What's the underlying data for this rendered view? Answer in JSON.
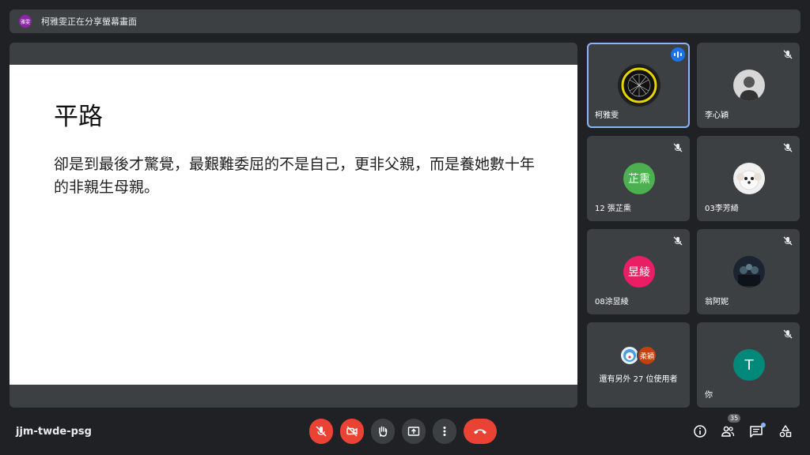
{
  "presentation_banner": {
    "avatar_text": "雅雯",
    "text": "柯雅雯正在分享螢幕畫面"
  },
  "slide": {
    "title": "平路",
    "body": "卻是到最後才驚覺，最艱難委屈的不是自己，更非父親，而是養她數十年的非親生母親。"
  },
  "participants": [
    {
      "name": "柯雅雯",
      "speaking": true
    },
    {
      "name": "李心穎",
      "muted": true
    },
    {
      "name": "12 張芷熏",
      "initials": "芷熏",
      "color": "#4caf50",
      "muted": true
    },
    {
      "name": "03李芳綺",
      "muted": true
    },
    {
      "name": "08涂昱綾",
      "initials": "昱綾",
      "color": "#e91e63",
      "muted": true
    },
    {
      "name": "翁阿妮",
      "muted": true
    },
    {
      "name": "還有另外 27 位使用者",
      "extra_avatar_text": "柔穎"
    },
    {
      "name": "你",
      "initials": "T",
      "color": "#00897b",
      "muted": true
    }
  ],
  "toolbar": {
    "meeting_code": "jjm-twde-psg",
    "people_count": "35"
  },
  "colors": {
    "background": "#202124",
    "danger": "#ea4335",
    "active_border": "#8ab4f8",
    "speaker_badge": "#1a73e8"
  }
}
